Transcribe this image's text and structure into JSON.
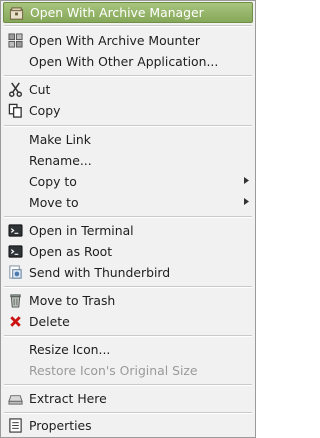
{
  "menu": {
    "items": [
      {
        "label": "Open With Archive Manager",
        "icon": "archive-manager-icon"
      },
      {
        "label": "Open With Archive Mounter",
        "icon": "archive-mounter-icon"
      },
      {
        "label": "Open With Other Application..."
      },
      {
        "label": "Cut",
        "icon": "scissors-icon"
      },
      {
        "label": "Copy",
        "icon": "copy-icon"
      },
      {
        "label": "Make Link"
      },
      {
        "label": "Rename..."
      },
      {
        "label": "Copy to",
        "submenu": true
      },
      {
        "label": "Move to",
        "submenu": true
      },
      {
        "label": "Open in Terminal",
        "icon": "terminal-icon"
      },
      {
        "label": "Open as Root",
        "icon": "terminal-root-icon"
      },
      {
        "label": "Send with Thunderbird",
        "icon": "thunderbird-send-icon"
      },
      {
        "label": "Move to Trash",
        "icon": "trash-icon"
      },
      {
        "label": "Delete",
        "icon": "delete-x-icon"
      },
      {
        "label": "Resize Icon..."
      },
      {
        "label": "Restore Icon's Original Size",
        "disabled": true
      },
      {
        "label": "Extract Here",
        "icon": "extract-drive-icon"
      },
      {
        "label": "Properties",
        "icon": "properties-icon"
      }
    ],
    "highlight_color": "#94b46a",
    "delete_color": "#cc1111"
  }
}
